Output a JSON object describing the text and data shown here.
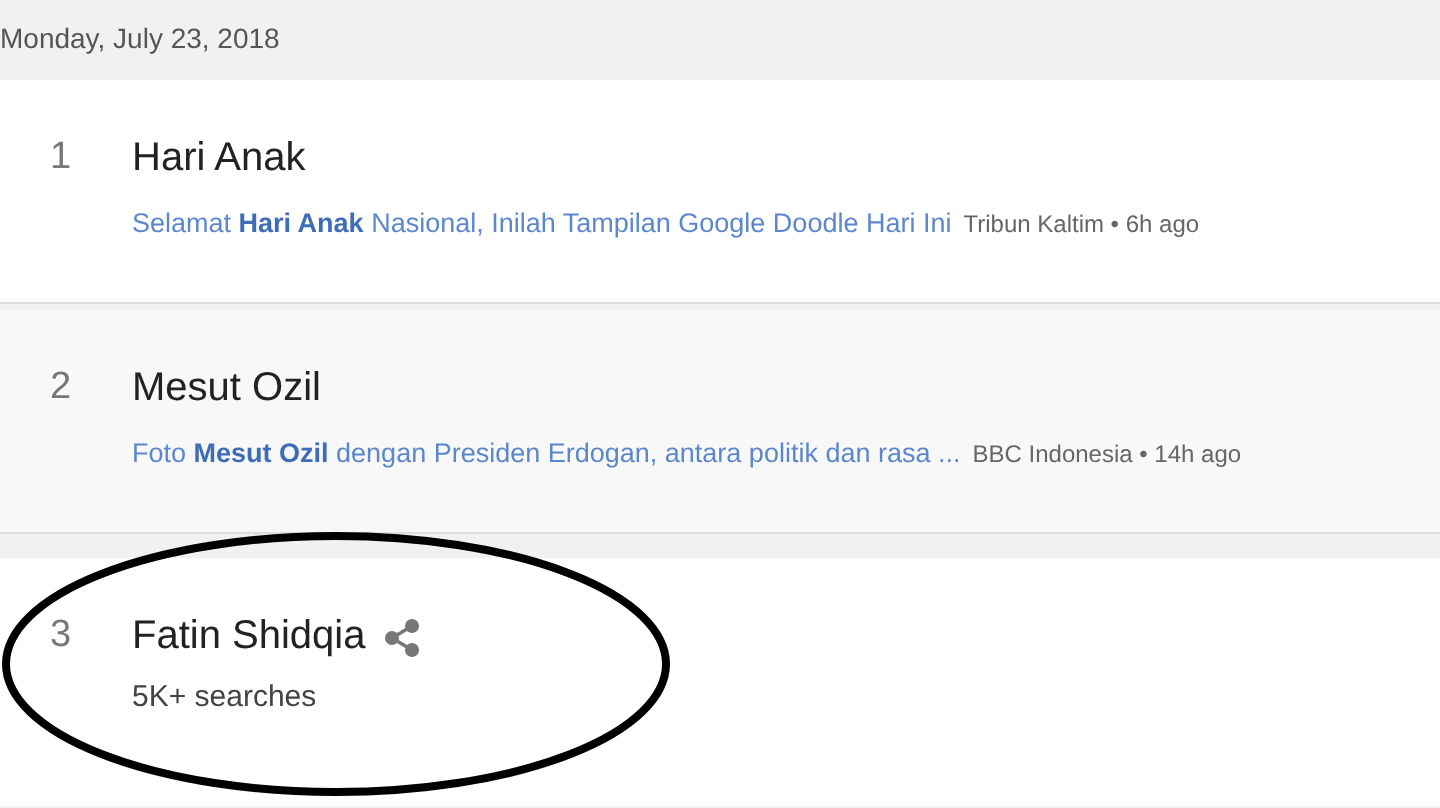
{
  "date": "Monday, July 23, 2018",
  "trends": [
    {
      "kind": "article",
      "rank": "1",
      "title": "Hari Anak",
      "hovered": false,
      "circled": false,
      "article": "Selamat **Hari Anak** Nasional, Inilah Tampilan Google Doodle Hari Ini",
      "source": "Tribun Kaltim • 6h ago"
    },
    {
      "kind": "article",
      "rank": "2",
      "title": "Mesut Ozil",
      "hovered": true,
      "circled": false,
      "article": "Foto **Mesut Ozil** dengan Presiden Erdogan, antara politik dan rasa ...",
      "source": "BBC Indonesia • 14h ago"
    },
    {
      "kind": "searches",
      "rank": "3",
      "title": "Fatin Shidqia",
      "hovered": false,
      "circled": true,
      "searches": "5K+ searches"
    }
  ]
}
